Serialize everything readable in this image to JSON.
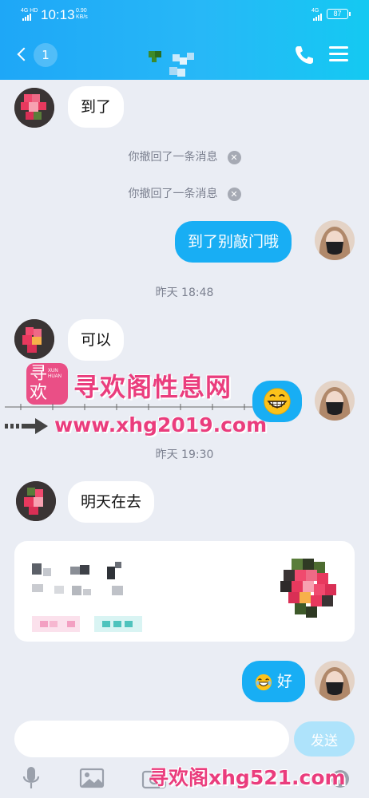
{
  "status_bar": {
    "network_left": "4G HD",
    "time": "10:13",
    "net_speed_value": "0.90",
    "net_speed_unit": "KB/s",
    "network_right": "4G",
    "battery": "87"
  },
  "nav": {
    "unread_count": "1"
  },
  "messages": [
    {
      "side": "in",
      "text": "到了"
    },
    {
      "type": "system",
      "text": "你撤回了一条消息"
    },
    {
      "type": "system",
      "text": "你撤回了一条消息"
    },
    {
      "side": "out",
      "text": "到了别敲门哦"
    },
    {
      "type": "time",
      "text": "昨天 18:48"
    },
    {
      "side": "in",
      "text": "可以"
    },
    {
      "side": "out",
      "emoji": "grinning-face"
    },
    {
      "type": "time",
      "text": "昨天 19:30"
    },
    {
      "side": "in",
      "text": "明天在去"
    },
    {
      "side": "out",
      "text": "好",
      "emoji": "laughing-face"
    }
  ],
  "watermark": {
    "logo_char": "寻欢",
    "logo_small": "XUN HUAN",
    "title": "寻欢阁性息网",
    "url": "www.xhg2019.com",
    "bottom": "寻欢阁xhg521.com"
  },
  "input": {
    "value": "",
    "send_label": "发送"
  },
  "colors": {
    "header": "#1ea7f7",
    "bubble_out": "#18aef4",
    "bubble_in": "#ffffff",
    "background": "#eaedf4",
    "watermark": "#ea3d7d"
  }
}
